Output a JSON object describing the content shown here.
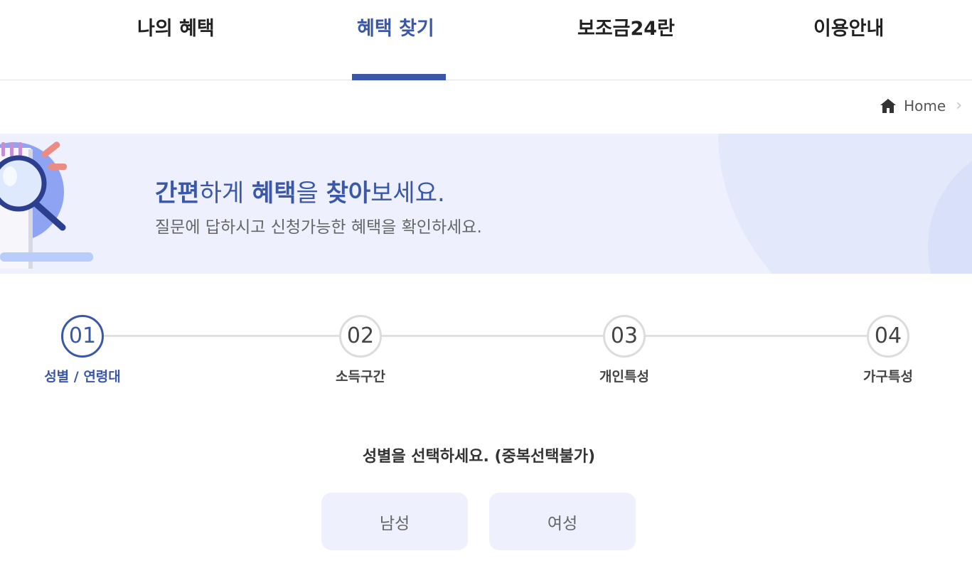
{
  "nav": {
    "items": [
      {
        "label": "나의 혜택",
        "active": false
      },
      {
        "label": "혜택 찾기",
        "active": true
      },
      {
        "label": "보조금24란",
        "active": false
      },
      {
        "label": "이용안내",
        "active": false
      }
    ]
  },
  "breadcrumb": {
    "home_icon": "home-icon",
    "home_label": "Home"
  },
  "banner": {
    "title_parts": [
      "간편",
      "하게 ",
      "혜택",
      "을 ",
      "찾아",
      "보세요."
    ],
    "subtitle": "질문에 답하시고 신청가능한 혜택을 확인하세요."
  },
  "steps": [
    {
      "number": "01",
      "label": "성별 / 연령대",
      "active": true
    },
    {
      "number": "02",
      "label": "소득구간",
      "active": false
    },
    {
      "number": "03",
      "label": "개인특성",
      "active": false
    },
    {
      "number": "04",
      "label": "가구특성",
      "active": false
    }
  ],
  "question": {
    "text": "성별을 선택하세요. (중복선택불가)",
    "options": [
      "남성",
      "여성"
    ]
  },
  "colors": {
    "accent": "#3a57a8",
    "banner_bg": "#eef1fd",
    "option_bg": "#eef1fd"
  }
}
